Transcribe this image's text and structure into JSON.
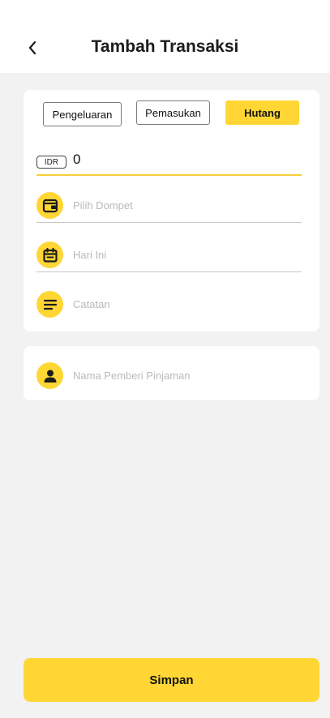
{
  "header": {
    "title": "Tambah Transaksi",
    "back_icon": "chevron-left-icon"
  },
  "tabs": [
    {
      "label": "Pengeluaran",
      "active": false
    },
    {
      "label": "Pemasukan",
      "active": false
    },
    {
      "label": "Hutang",
      "active": true
    }
  ],
  "amount": {
    "currency": "IDR",
    "value": "0"
  },
  "fields": {
    "wallet": {
      "placeholder": "Pilih Dompet",
      "icon": "wallet-icon"
    },
    "date": {
      "placeholder": "Hari Ini",
      "icon": "calendar-icon"
    },
    "note": {
      "placeholder": "Catatan",
      "icon": "notes-icon"
    },
    "lender": {
      "placeholder": "Nama Pemberi Pinjaman",
      "icon": "person-icon"
    }
  },
  "actions": {
    "save_label": "Simpan"
  },
  "colors": {
    "accent": "#ffd634",
    "background": "#f2f2f2",
    "card": "#ffffff",
    "placeholder": "#b9b9b9"
  }
}
